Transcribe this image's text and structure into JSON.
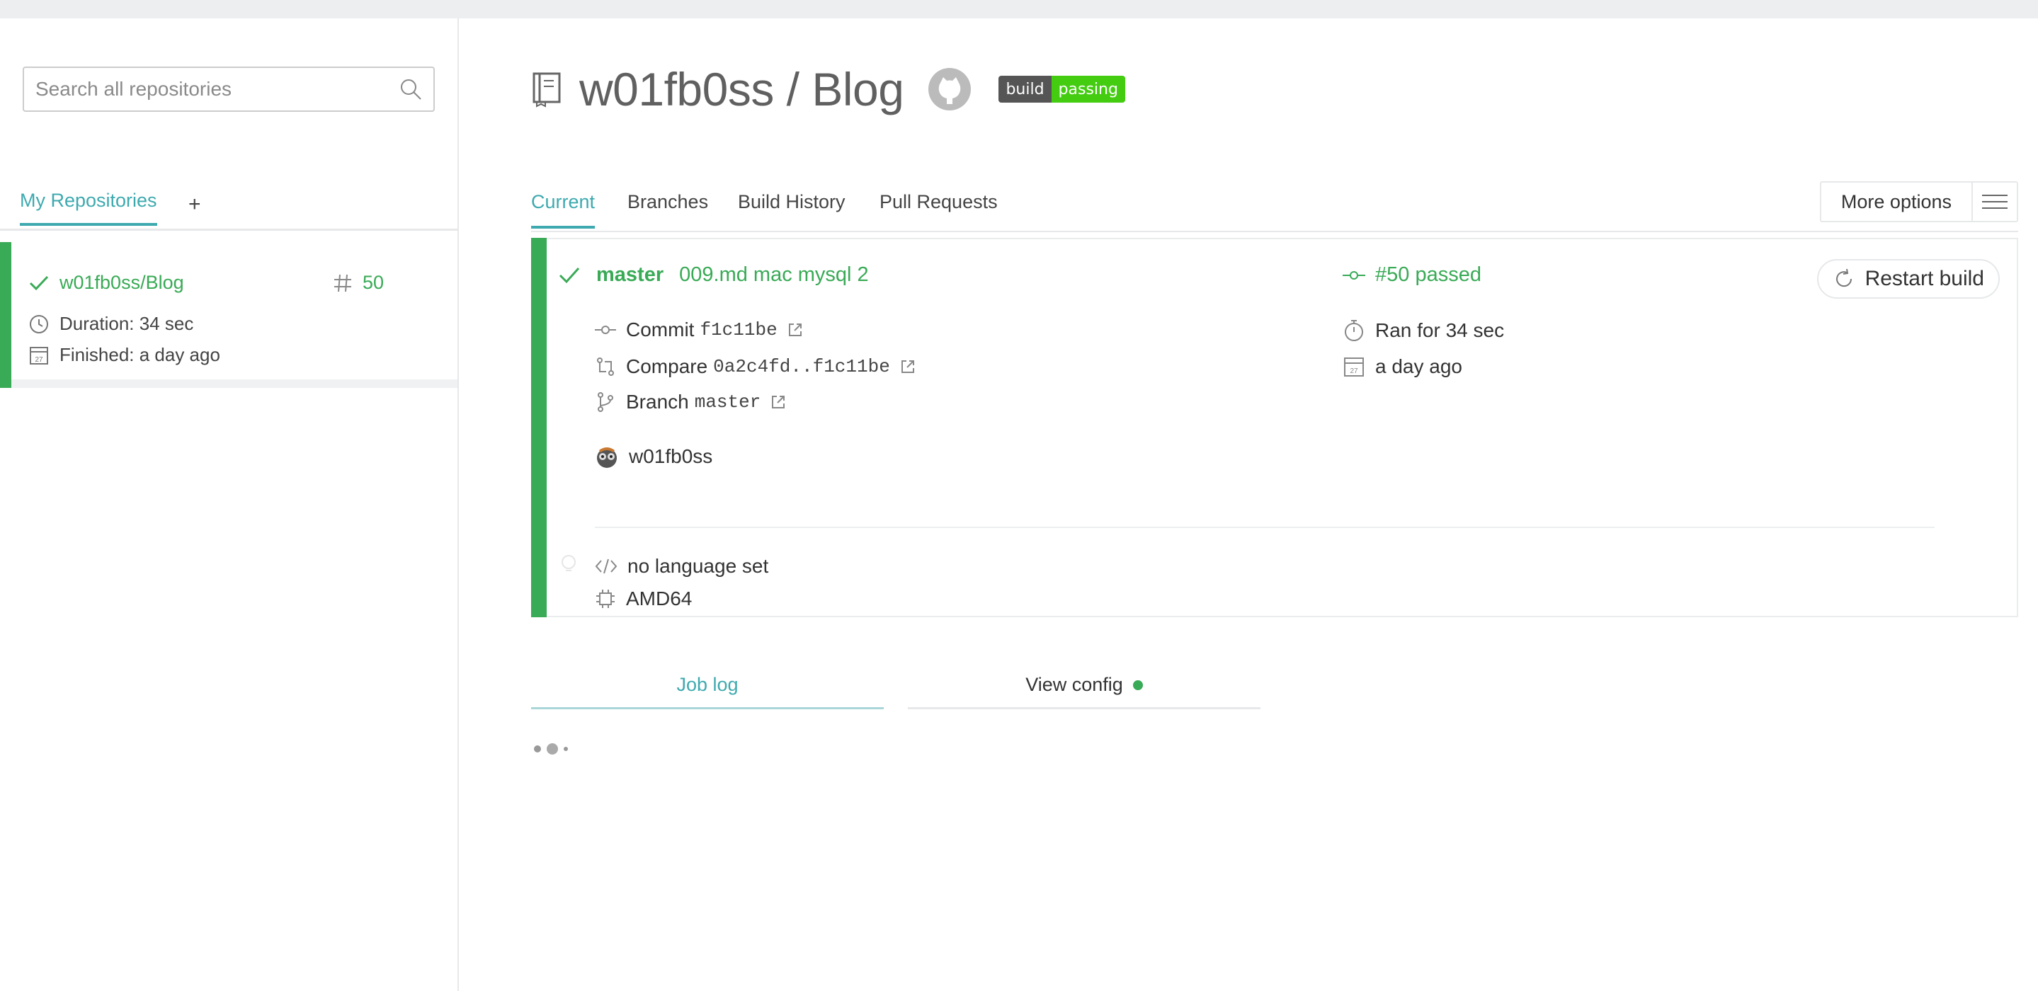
{
  "sidebar": {
    "search_placeholder": "Search all repositories",
    "tab_label": "My Repositories",
    "add_label": "+",
    "repo": {
      "name": "w01fb0ss/Blog",
      "build_number": "50",
      "duration": "Duration: 34 sec",
      "finished": "Finished: a day ago"
    }
  },
  "header": {
    "title": "w01fb0ss / Blog",
    "badge_left": "build",
    "badge_right": "passing"
  },
  "tabs": [
    {
      "label": "Current"
    },
    {
      "label": "Branches"
    },
    {
      "label": "Build History"
    },
    {
      "label": "Pull Requests"
    }
  ],
  "more_options_label": "More options",
  "build": {
    "branch": "master",
    "message": "009.md mac mysql 2",
    "status": "#50 passed",
    "restart_label": "Restart build",
    "commit_label": "Commit",
    "commit_sha": "f1c11be",
    "compare_label": "Compare",
    "compare_range": "0a2c4fd..f1c11be",
    "branch_label": "Branch",
    "branch_name": "master",
    "author": "w01fb0ss",
    "ran_for": "Ran for 34 sec",
    "finished": "a day ago",
    "language": "no language set",
    "arch": "AMD64",
    "calendar_day": "27"
  },
  "log_tabs": {
    "job_log": "Job log",
    "view_config": "View config"
  },
  "colors": {
    "passed_green": "#39aa56",
    "accent_teal": "#3eaaaf",
    "badge_green": "#44cc11",
    "badge_gray": "#555555"
  }
}
